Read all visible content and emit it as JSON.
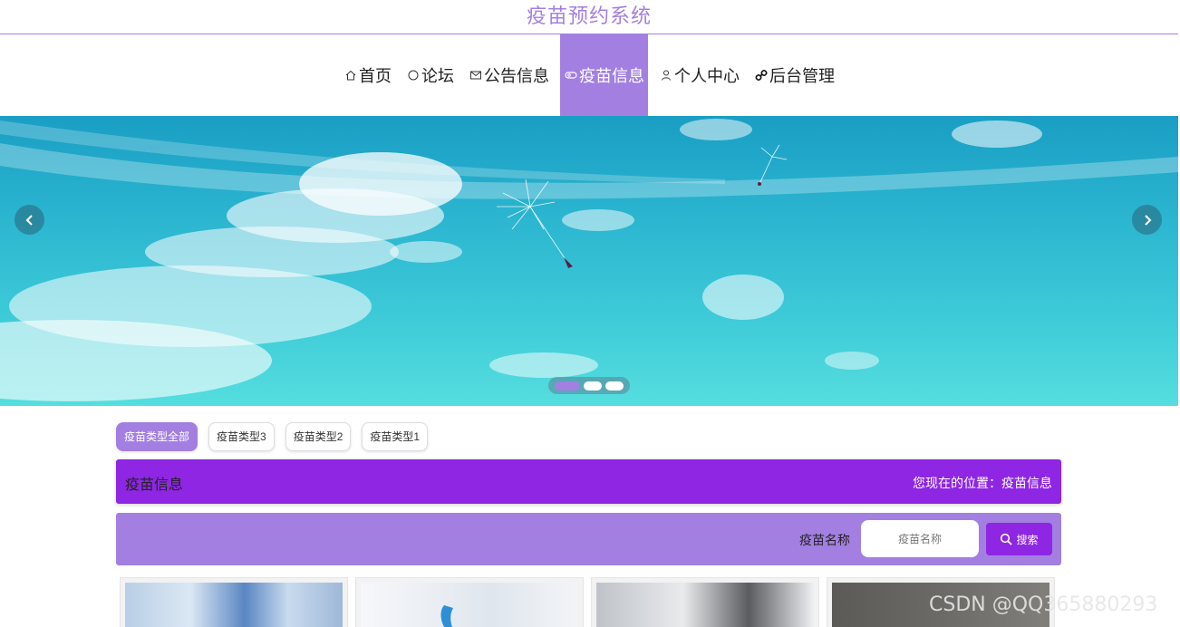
{
  "header": {
    "site_title": "疫苗预约系统"
  },
  "nav": {
    "items": [
      {
        "label": "首页",
        "icon": "home-icon",
        "active": false
      },
      {
        "label": "论坛",
        "icon": "chat-icon",
        "active": false
      },
      {
        "label": "公告信息",
        "icon": "mail-icon",
        "active": false
      },
      {
        "label": "疫苗信息",
        "icon": "pill-icon",
        "active": true
      },
      {
        "label": "个人中心",
        "icon": "user-icon",
        "active": false
      },
      {
        "label": "后台管理",
        "icon": "link-icon",
        "active": false
      }
    ]
  },
  "banner": {
    "slide_count": 3,
    "active_slide": 1
  },
  "filters": {
    "items": [
      {
        "label": "疫苗类型全部",
        "active": true
      },
      {
        "label": "疫苗类型3",
        "active": false
      },
      {
        "label": "疫苗类型2",
        "active": false
      },
      {
        "label": "疫苗类型1",
        "active": false
      }
    ]
  },
  "info_bar": {
    "title": "疫苗信息",
    "position_label": "您现在的位置：",
    "position_value": "疫苗信息"
  },
  "search": {
    "label": "疫苗名称",
    "placeholder": "疫苗名称",
    "value": "",
    "button_label": "搜索"
  },
  "watermark": "CSDN @QQ365880293",
  "colors": {
    "accent": "#a37fe2",
    "accent_dark": "#8e26e3"
  }
}
